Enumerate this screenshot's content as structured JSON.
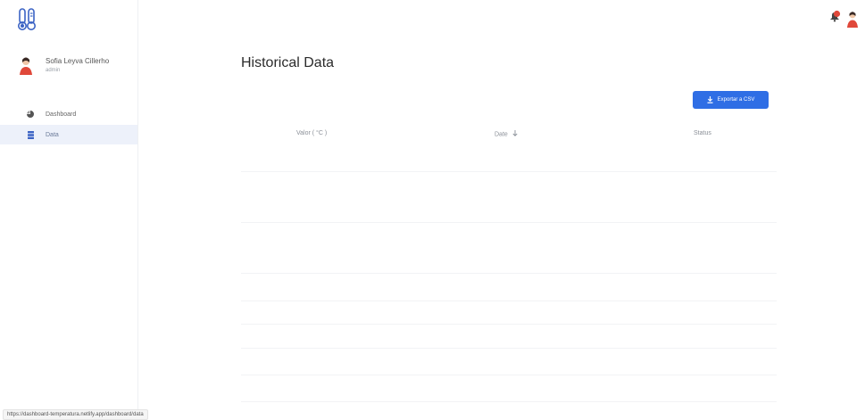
{
  "app": {
    "logo_icon": "thermometer-duo-icon",
    "accent_color": "#2f6ee5"
  },
  "user": {
    "name": "Sofia Leyva Cillerho",
    "role": "admin",
    "avatar_icon": "user-avatar-icon"
  },
  "sidebar": {
    "items": [
      {
        "label": "Dashboard",
        "icon": "pie-chart-icon",
        "active": false
      },
      {
        "label": "Data",
        "icon": "database-icon",
        "active": true
      }
    ]
  },
  "header": {
    "notification_icon": "bell-icon",
    "profile_icon": "user-avatar-icon"
  },
  "main": {
    "title": "Historical Data",
    "export_button_label": "Exportar a CSV",
    "export_icon": "download-icon"
  },
  "table": {
    "columns": [
      "Valor ( °C )",
      "Date",
      "Status"
    ],
    "sort_icon": "sort-arrow-icon",
    "rows": []
  },
  "status_bar": {
    "url": "https://dashboard-temperatura.netlify.app/dashboard/data"
  }
}
